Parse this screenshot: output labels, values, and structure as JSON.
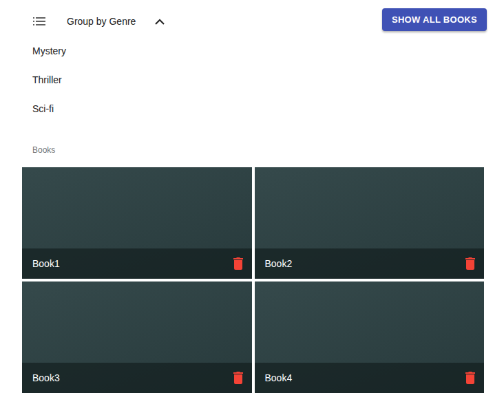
{
  "toolbar": {
    "group_label": "Group by Genre",
    "expanded": true
  },
  "button": "SHOW ALL BOOKS",
  "genres": [
    "Mystery",
    "Thriller",
    "Sci-fi"
  ],
  "books_header": "Books",
  "books": [
    "Book1",
    "Book2",
    "Book3",
    "Book4"
  ]
}
